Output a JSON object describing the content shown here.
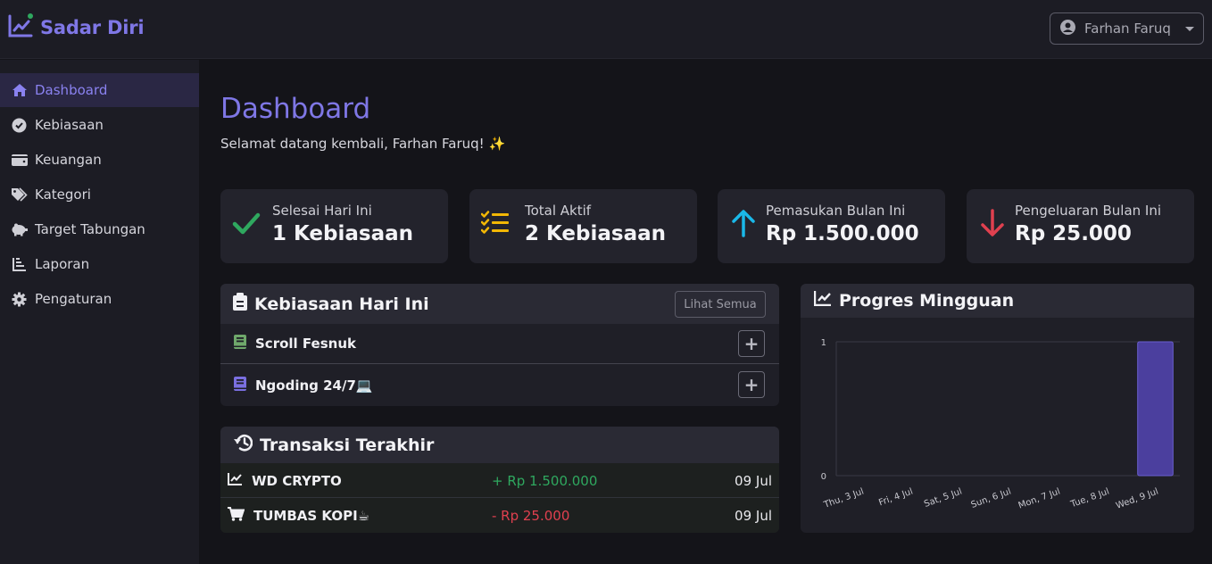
{
  "app": {
    "brand": "Sadar Diri",
    "user_name": "Farhan Faruq"
  },
  "sidebar": {
    "items": [
      {
        "label": "Dashboard",
        "icon": "home-icon",
        "active": true
      },
      {
        "label": "Kebiasaan",
        "icon": "check-circle-icon"
      },
      {
        "label": "Keuangan",
        "icon": "wallet-icon"
      },
      {
        "label": "Kategori",
        "icon": "tags-icon"
      },
      {
        "label": "Target Tabungan",
        "icon": "piggy-bank-icon"
      },
      {
        "label": "Laporan",
        "icon": "chart-icon"
      },
      {
        "label": "Pengaturan",
        "icon": "gear-icon"
      }
    ]
  },
  "main": {
    "title": "Dashboard",
    "subtitle": "Selamat datang kembali, Farhan Faruq! ✨"
  },
  "stats": [
    {
      "label": "Selesai Hari Ini",
      "value": "1 Kebiasaan",
      "icon": "check-icon",
      "color": "#2fa85f"
    },
    {
      "label": "Total Aktif",
      "value": "2 Kebiasaan",
      "icon": "list-check-icon",
      "color": "#f2b705"
    },
    {
      "label": "Pemasukan Bulan Ini",
      "value": "Rp 1.500.000",
      "icon": "arrow-up-icon",
      "color": "#1ab8e8"
    },
    {
      "label": "Pengeluaran Bulan Ini",
      "value": "Rp 25.000",
      "icon": "arrow-down-icon",
      "color": "#e0404f"
    }
  ],
  "habits": {
    "title": "Kebiasaan Hari Ini",
    "view_all_label": "Lihat Semua",
    "items": [
      {
        "name": "Scroll Fesnuk",
        "icon": "book-icon",
        "color": "#6fa86b"
      },
      {
        "name": "Ngoding 24/7💻",
        "icon": "book-icon",
        "color": "#7a6fe0"
      }
    ],
    "add_label": "+"
  },
  "transactions": {
    "title": "Transaksi Terakhir",
    "items": [
      {
        "name": "WD CRYPTO",
        "amount": "+ Rp 1.500.000",
        "date": "09 Jul",
        "type": "in",
        "icon": "chart-line-icon"
      },
      {
        "name": "TUMBAS KOPI☕",
        "amount": "- Rp 25.000",
        "date": "09 Jul",
        "type": "out",
        "icon": "cart-icon"
      }
    ]
  },
  "weekly": {
    "title": "Progres Mingguan"
  },
  "chart_data": {
    "type": "bar",
    "categories": [
      "Thu, 3 Jul",
      "Fri, 4 Jul",
      "Sat, 5 Jul",
      "Sun, 6 Jul",
      "Mon, 7 Jul",
      "Tue, 8 Jul",
      "Wed, 9 Jul"
    ],
    "values": [
      0,
      0,
      0,
      0,
      0,
      0,
      1
    ],
    "ylim": [
      0,
      1
    ],
    "yticks": [
      "0",
      "1"
    ],
    "bar_color": "#4b3f9e",
    "grid": true
  }
}
